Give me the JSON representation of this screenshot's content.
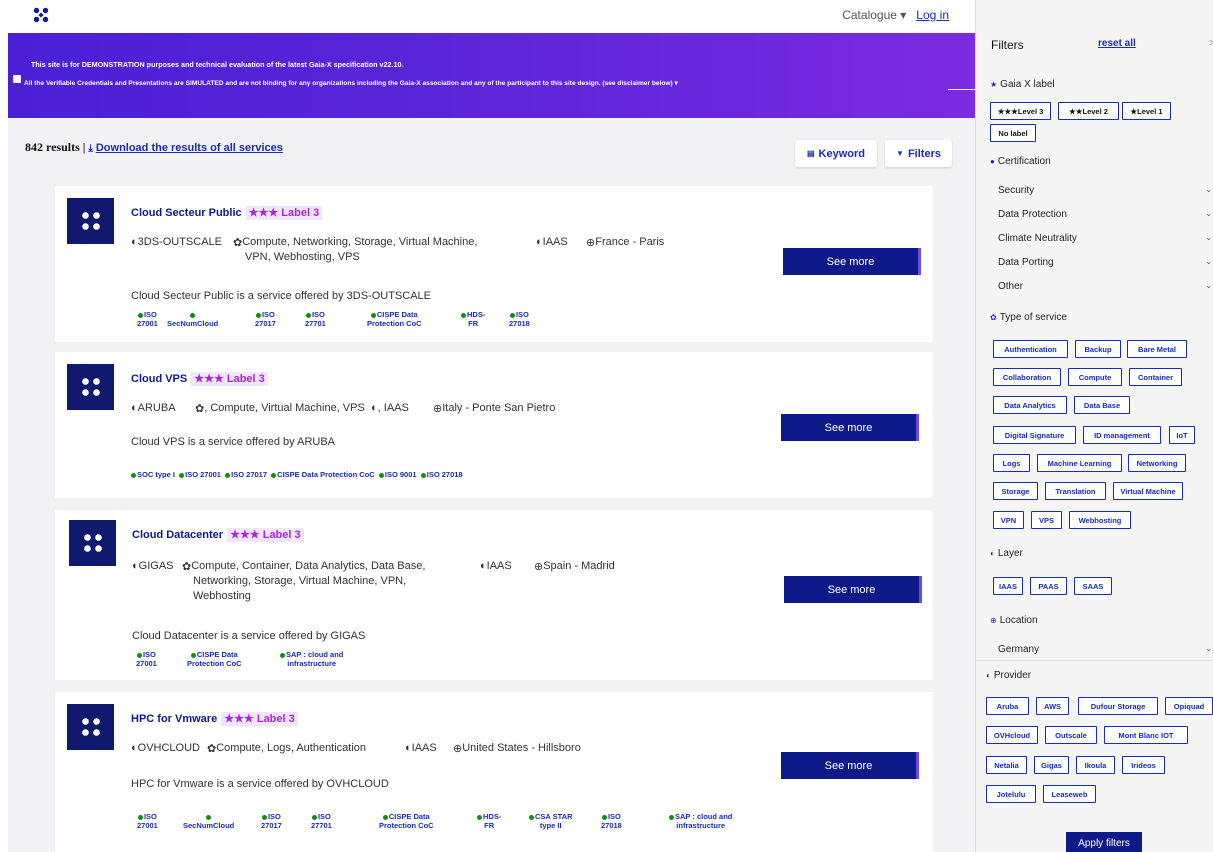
{
  "nav": {
    "catalogue": "Catalogue ▾",
    "login": "Log in"
  },
  "banner": {
    "line1": "This site is for DEMONSTRATION purposes and technical evaluation of the latest Gaia-X specification v22.10.",
    "line2": "All the Verifiable Credentials and Presentations are SIMULATED and are not binding for any organizations including the Gaia-X association and any of the participant to this site design. (see disclaimer below) ▾"
  },
  "results": {
    "count": "842 results |",
    "download": "Download the results of all services"
  },
  "buttons": {
    "keyword": "Keyword",
    "filters": "Filters",
    "see_more": "See more",
    "apply": "Apply filters"
  },
  "cards": [
    {
      "title": "Cloud Secteur Public",
      "label": "★★★ Label 3",
      "provider": "3DS-OUTSCALE",
      "types": "Compute, Networking, Storage, Virtual Machine,",
      "types2": "VPN, Webhosting, VPS",
      "layer": "IAAS",
      "location": "France - Paris",
      "desc": "Cloud Secteur Public is a service offered by 3DS-OUTSCALE",
      "certs": [
        [
          "ISO",
          "27001"
        ],
        [
          "",
          "SecNumCloud"
        ],
        [
          "ISO",
          "27017"
        ],
        [
          "ISO",
          "27701"
        ],
        [
          "CISPE Data",
          "Protection CoC"
        ],
        [
          "HDS-",
          "FR"
        ],
        [
          "ISO",
          "27018"
        ]
      ]
    },
    {
      "title": "Cloud VPS",
      "label": "★★★ Label 3",
      "provider": "ARUBA",
      "types": ", Compute, Virtual Machine, VPS",
      "layer": ", IAAS",
      "location": "Italy - Ponte San Pietro",
      "desc": "Cloud VPS is a service offered by ARUBA",
      "certs_line": [
        "SOC type I",
        "ISO 27001",
        "ISO 27017",
        "CISPE Data Protection CoC",
        "ISO 9001",
        "ISO 27018"
      ]
    },
    {
      "title": "Cloud Datacenter",
      "label": "★★★ Label 3",
      "provider": "GIGAS",
      "types": "Compute, Container, Data Analytics, Data Base,",
      "types2": "Networking, Storage, Virtual Machine, VPN,",
      "types3": "Webhosting",
      "layer": "IAAS",
      "location": "Spain - Madrid",
      "desc": "Cloud Datacenter is a service offered by GIGAS",
      "certs": [
        [
          "ISO",
          "27001"
        ],
        [
          "CISPE Data",
          "Protection CoC"
        ],
        [
          "SAP : cloud and",
          "infrastructure"
        ]
      ]
    },
    {
      "title": "HPC for Vmware",
      "label": "★★★ Label 3",
      "provider": "OVHCLOUD",
      "types": "Compute, Logs, Authentication",
      "layer": "IAAS",
      "location": "United States - Hillsboro",
      "desc": "HPC for Vmware is a service offered by OVHCLOUD",
      "certs": [
        [
          "ISO",
          "27001"
        ],
        [
          "",
          "SecNumCloud"
        ],
        [
          "ISO",
          "27017"
        ],
        [
          "ISO",
          "27701"
        ],
        [
          "CISPE Data",
          "Protection CoC"
        ],
        [
          "HDS-",
          "FR"
        ],
        [
          "CSA STAR",
          "type II"
        ],
        [
          "ISO",
          "27018"
        ],
        [
          "SAP : cloud and",
          "infrastructure"
        ]
      ]
    }
  ],
  "sidebar": {
    "title": "Filters",
    "reset": "reset all",
    "close": ">",
    "gaiax_label": "Gaia X label",
    "levels": [
      "★★★Level 3",
      "★★Level 2",
      "★Level 1",
      "No label"
    ],
    "certification": "Certification",
    "cert_dropdowns": [
      "Security",
      "Data Protection",
      "Climate Neutrality",
      "Data Porting",
      "Other"
    ],
    "type_of_service": "Type of service",
    "service_types": [
      "Authentication",
      "Backup",
      "Bare Metal",
      "Collaboration",
      "Compute",
      "Container",
      "Data Analytics",
      "Data Base",
      "Digital Signature",
      "ID management",
      "IoT",
      "Logs",
      "Machine Learning",
      "Networking",
      "Storage",
      "Translation",
      "Virtual Machine",
      "VPN",
      "VPS",
      "Webhosting"
    ],
    "layer": "Layer",
    "layers": [
      "IAAS",
      "PAAS",
      "SAAS"
    ],
    "location": "Location",
    "location_value": "Germany",
    "provider": "Provider",
    "providers": [
      "Aruba",
      "AWS",
      "Dufour Storage",
      "Opiquad",
      "OVHcloud",
      "Outscale",
      "Mont Blanc IOT",
      "Netalia",
      "Gigas",
      "Ikoula",
      "Irideos",
      "Jotelulu",
      "Leaseweb"
    ]
  }
}
